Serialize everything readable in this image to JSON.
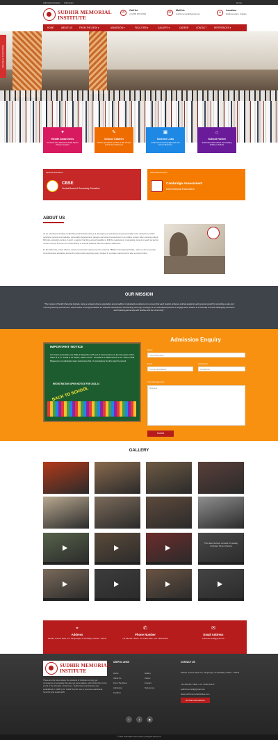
{
  "topbar": {
    "left1": "Admission Enquiry",
    "left2": "Admission",
    "right": "Home"
  },
  "header": {
    "logo_line1": "SUDHIR MEMORIAL",
    "logo_line2": "INSTITUTE",
    "call_title": "Call Us",
    "call_value": "+91 983 000 07000",
    "mail_title": "Mail Us",
    "mail_value": "sudhirmemorial@gmail.com",
    "loc_title": "Location",
    "loc_value": "Madhyamgram, Kolkata"
  },
  "nav": [
    "HOME",
    "ABOUT US",
    "FROM THE DESK ▾",
    "ADMISSION ▾",
    "FACILITIES ▾",
    "GALLERY ▾",
    "CAREER",
    "CONTACT",
    "REFERENCES ▾"
  ],
  "sidetab": "Attendance Portal Online",
  "features": [
    {
      "icon": "✦",
      "title": "Health Awareness",
      "text": "Conducts drive addresses at SMI Tripura Pleasure inspired",
      "color": "#d81b60"
    },
    {
      "icon": "✎",
      "title": "School Cabinet",
      "text": "Initiates specialised activities at SMI mindset and Student Parliament",
      "color": "#ef6c00"
    },
    {
      "icon": "▣",
      "title": "Science Labs",
      "text": "Advanced and well-equipped lab and Science Branches",
      "color": "#1e88e5"
    },
    {
      "icon": "⌂",
      "title": "School Hostel",
      "text": "Sudhir Memorial Institute has boarding facilities in Kolkata",
      "color": "#6a1b9a"
    }
  ],
  "affiliation": [
    {
      "label": "AFFILIATION WITH",
      "name": "CBSE",
      "sub": "Central Board of Secondary Education",
      "color": "#c62828"
    },
    {
      "label": "AFFILIATION WITH",
      "name": "Cambridge Assessment",
      "sub": "International Education",
      "color": "#f57c00"
    }
  ],
  "about": {
    "heading": "ABOUT US",
    "p1": "As an educational institute Sudhir Memorial Institute strives at developing a multi-dimensional personality in the students by which upholding pursuit of knowledge, personality development, passion and career development in a positive society. After surveying about 600 plus education centres in such a manner that they enough capable to fulfil the requirement of education proves to reach as well at modern society and from the observations of several students that this makes a difference.",
    "p2": "To this effect the school offers a variety of curricular options from the national CBSE to International (CCE) - with our aim to provide comprehensive education across the school and supporting every student in a unique manner and is also a proven future."
  },
  "mission": {
    "heading": "OUR MISSION",
    "text": "\"The mission of Sudhir Memorial Institute, being a uniquely diverse population and a tradition of standards excellence is to ensure that each student achieves optimal academic and personal growth by providing a safe and nurturing learning environment, which fosters a strong foundation for character development and thinking and may, serving as a rich educational practice to engage each student in a culturally rich and challenging curriculum and fostering partnership with families and the community.\""
  },
  "notice": {
    "heading": "IMPORTANT NOTICE",
    "text": "Our board examination are ONE of September with rest of local sessions on the time given further. Class IX & XI - 11AM to 12 NOON, Class IX & XI - 12:30PM to 1:30PM and XI & XII - 2PM to 3PM. Please join our admission team and ensure that it is compulsory for all to sign the record.",
    "registration": "REGISTRATION OPEN NOTICE FOR 2023-24",
    "bts": "BACK TO SCHOOL"
  },
  "enquiry": {
    "heading": "Admission Enquiry",
    "name_label": "Name",
    "name_ph": "Your Name Here",
    "email_label": "Email",
    "email_ph": "Your Email Address",
    "contact_label": "Contact No",
    "contact_ph": "Contact No",
    "msg_label": "Your Message Here",
    "msg_ph": "Message",
    "submit": "Submit"
  },
  "gallery": {
    "heading": "GALLERY",
    "items": [
      {
        "c": "#b33a1a",
        "v": false
      },
      {
        "c": "#8a6a4e",
        "v": false
      },
      {
        "c": "#6e5a44",
        "v": false
      },
      {
        "c": "#5a3f3a",
        "v": false
      },
      {
        "c": "#b9a990",
        "v": false
      },
      {
        "c": "#7c6b5a",
        "v": false
      },
      {
        "c": "#5e4a3c",
        "v": false
      },
      {
        "c": "#8f8f8f",
        "v": false
      },
      {
        "c": "#56624a",
        "v": true
      },
      {
        "c": "#5b4a3a",
        "v": true
      },
      {
        "c": "#6d2c2c",
        "v": true
      },
      {
        "c": "#4a4a4a",
        "v": true
      },
      {
        "c": "#7a6a5a",
        "v": true
      },
      {
        "c": "#3c3c3c",
        "v": true
      },
      {
        "c": "#6a5444",
        "v": true
      },
      {
        "c": "#444444",
        "v": true
      }
    ],
    "video_caption": "This video has been removed for violating YouTube's Terms of Service"
  },
  "contact_bar": [
    {
      "icon": "⌖",
      "title": "Address",
      "value": "Daltulla, Jessore Road, P.O: Sanganagar, 24 PGNS(N), Kolkata - 700132"
    },
    {
      "icon": "✆",
      "title": "Phone Number",
      "value": "+91 983 0017 0000 / +91 74930 0000 / +91 74030 00276"
    },
    {
      "icon": "✉",
      "title": "Email Address",
      "value": "sudhirmemorial@gmail.com"
    }
  ],
  "footer": {
    "about_text": "These are the focus where the students of Institute not only get competence in education but also get personalities, which help them to be proud of the shoulder of their lives. Sudhir Memorial Institute was established in 1948 by Dr. Sudhir Kumar Sen to promote educational, honorific and social uplift.",
    "useful_heading": "USEFUL LINKS",
    "links_col1": [
      "Home",
      "About Us",
      "From The Desk",
      "Admission",
      "Facilities"
    ],
    "links_col2": [
      "Gallery",
      "Career",
      "Contact",
      "References"
    ],
    "contact_heading": "CONTACT US",
    "contact_lines": [
      "Daltulla, Jessore Road, P.O: Sanganagar, 24 PGNS(N), Kolkata - 700132",
      "+91 983 0017 0000 / +91 74930 00276",
      "sudhirmemorial@gmail.com",
      "www.sudhirmemorialinstitute.com"
    ],
    "enquiry_btn": "ENTER CHALLENGE",
    "copyright": "© 2020 Sudhir Memorial Institute | All Rights Reserved"
  }
}
